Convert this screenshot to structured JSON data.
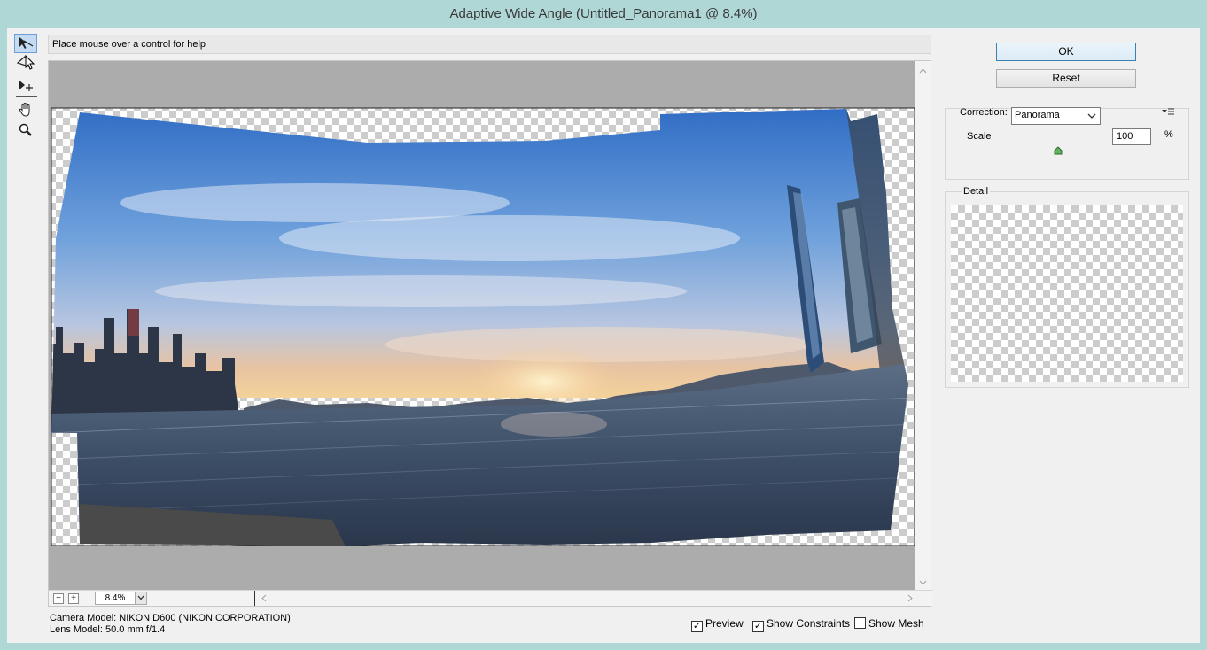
{
  "window": {
    "title": "Adaptive Wide Angle (Untitled_Panorama1 @ 8.4%)"
  },
  "toolbar": {
    "icons": [
      "constraint-tool-icon",
      "polygon-constraint-tool-icon",
      "move-tool-icon",
      "hand-tool-icon",
      "zoom-tool-icon"
    ]
  },
  "help": {
    "text": "Place mouse over a control for help"
  },
  "zoom": {
    "minus": "−",
    "plus": "+",
    "value": "8.4%"
  },
  "camera": {
    "model": "Camera Model: NIKON D600 (NIKON CORPORATION)",
    "lens": "Lens Model: 50.0 mm f/1.4"
  },
  "options": {
    "preview": {
      "label": "Preview",
      "checked": true
    },
    "constraints": {
      "label": "Show Constraints",
      "checked": true
    },
    "mesh": {
      "label": "Show Mesh",
      "checked": false
    }
  },
  "buttons": {
    "ok": "OK",
    "reset": "Reset"
  },
  "correction": {
    "label": "Correction:",
    "value": "Panorama",
    "scale_label": "Scale",
    "scale_value": "100",
    "scale_unit": "%",
    "scale_level": 0.5
  },
  "detail": {
    "label": "Detail"
  },
  "colors": {
    "accent": "#3c7fb1",
    "titlebar": "#aed7d6"
  }
}
